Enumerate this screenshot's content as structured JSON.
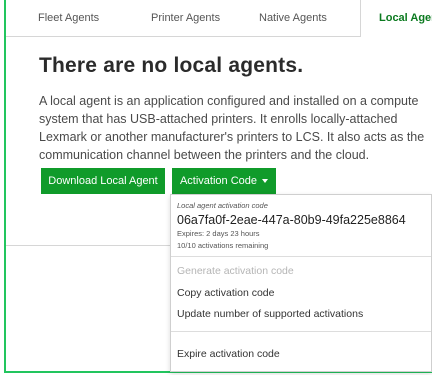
{
  "tabs": {
    "fleet": "Fleet Agents",
    "printer": "Printer Agents",
    "native": "Native Agents",
    "local": "Local Agen"
  },
  "main": {
    "title": "There are no local agents.",
    "description_lines": [
      "A local agent is an application configured and installed on a compute",
      "system that has USB-attached printers. It enrolls locally-attached",
      "Lexmark or another manufacturer's printers to LCS. It also acts as the",
      "communication channel between the printers and the cloud."
    ],
    "download_button": "Download Local Agent",
    "activation_button": "Activation Code"
  },
  "dropdown": {
    "label": "Local agent activation code",
    "code": "06a7fa0f-2eae-447a-80b9-49fa225e8864",
    "expires": "Expires: 2 days 23 hours",
    "remaining": "10/10 activations remaining",
    "items": [
      "Generate activation code",
      "Copy activation code",
      "Update number of supported activations",
      "Expire activation code"
    ]
  },
  "colors": {
    "accent_green": "#109b2a",
    "active_tab_text": "#0b7a1f",
    "highlight_frame": "#22c55e"
  }
}
